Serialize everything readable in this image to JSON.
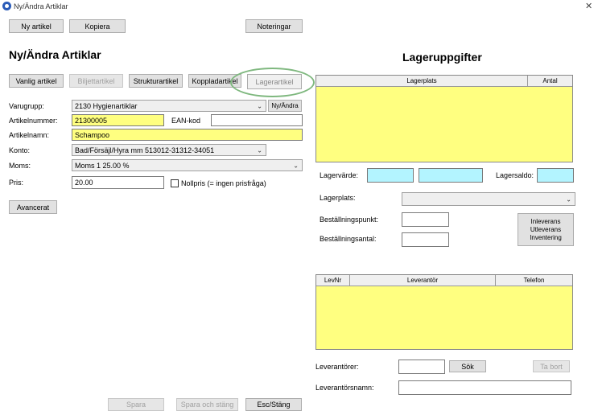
{
  "window": {
    "title": "Ny/Ändra Artiklar",
    "close_glyph": "✕"
  },
  "toolbar": {
    "new_article": "Ny artikel",
    "copy": "Kopiera",
    "notes": "Noteringar"
  },
  "left": {
    "heading": "Ny/Ändra Artiklar",
    "tabs": [
      "Vanlig artikel",
      "Biljettartikel",
      "Strukturartikel",
      "Koppladartikel",
      "Lagerartikel"
    ],
    "fields": {
      "varugrupp_label": "Varugrupp:",
      "varugrupp_value": "2130 Hygienartiklar",
      "new_edit_button": "Ny/Ändra",
      "artikelnummer_label": "Artikelnummer:",
      "artikelnummer_value": "21300005",
      "ean_label": "EAN-kod",
      "ean_value": "",
      "artikelnamn_label": "Artikelnamn:",
      "artikelnamn_value": "Schampoo",
      "konto_label": "Konto:",
      "konto_value": "Bad/Försäjl/Hyra mm 513012-31312-34051",
      "moms_label": "Moms:",
      "moms_value": "Moms 1 25.00 %",
      "pris_label": "Pris:",
      "pris_value": "20.00",
      "nollpris_label": "Nollpris (= ingen prisfråga)"
    },
    "advanced": "Avancerat"
  },
  "bottom": {
    "save": "Spara",
    "save_close": "Spara och stäng",
    "esc_close": "Esc/Stäng"
  },
  "right": {
    "heading": "Lageruppgifter",
    "stock_grid": {
      "columns": [
        "Lagerplats",
        "Antal"
      ]
    },
    "lagervarde_label": "Lagervärde:",
    "lagersaldo_label": "Lagersaldo:",
    "lagerplats_label": "Lagerplats:",
    "bestallningspunkt_label": "Beställningspunkt:",
    "bestallningsantal_label": "Beställningsantal:",
    "inleverans_button": [
      "Inleverans",
      "Utleverans",
      "Inventering"
    ],
    "supplier_grid": {
      "columns": [
        "LevNr",
        "Leverantör",
        "Telefon"
      ]
    },
    "leverantorer_label": "Leverantörer:",
    "search_button": "Sök",
    "remove_button": "Ta bort",
    "leverantorsnamn_label": "Leverantörsnamn:"
  },
  "colors": {
    "field_yellow": "#ffff80",
    "field_cyan": "#b3f4ff",
    "highlight": "#7fb87f"
  }
}
